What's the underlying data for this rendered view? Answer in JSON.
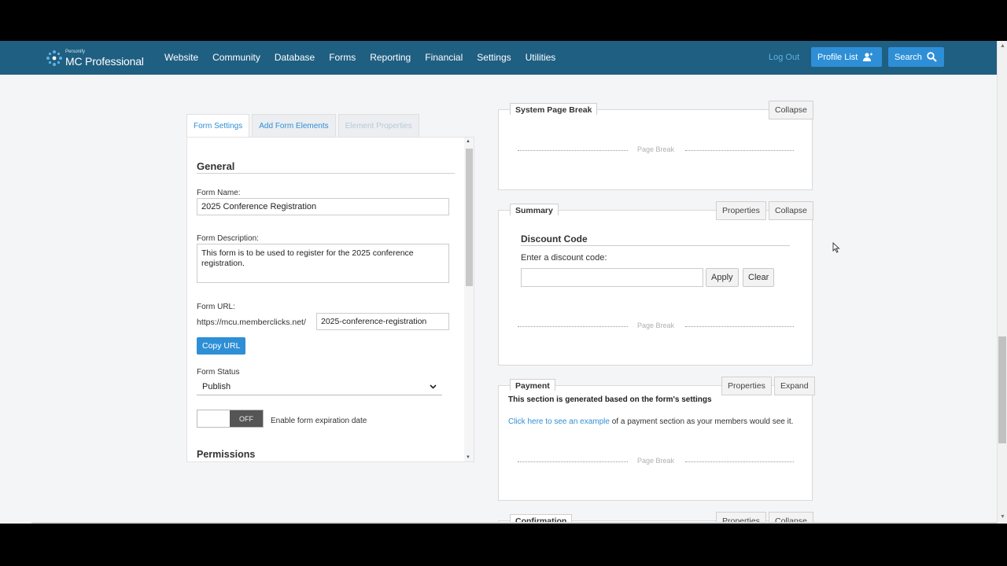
{
  "nav": {
    "logo_small": "Personify",
    "logo_big": "MC Professional",
    "items": [
      "Website",
      "Community",
      "Database",
      "Forms",
      "Reporting",
      "Financial",
      "Settings",
      "Utilities"
    ],
    "logout": "Log Out",
    "profile_list": "Profile List",
    "search": "Search"
  },
  "tabs": {
    "form_settings": "Form Settings",
    "add_form_elements": "Add Form Elements",
    "element_properties": "Element Properties"
  },
  "general": {
    "title": "General",
    "form_name_label": "Form Name:",
    "form_name_value": "2025 Conference Registration",
    "form_desc_label": "Form Description:",
    "form_desc_value": "This form is to be used to register for the 2025 conference registration.",
    "form_url_label": "Form URL:",
    "form_url_prefix": "https://mcu.memberclicks.net/",
    "form_url_slug": "2025-conference-registration",
    "copy_url": "Copy URL",
    "form_status_label": "Form Status",
    "form_status_value": "Publish",
    "toggle_state": "OFF",
    "expiration_label": "Enable form expiration date",
    "permissions_title": "Permissions"
  },
  "sections": {
    "page_break_text": "Page Break",
    "system_page_break": {
      "title": "System Page Break",
      "collapse": "Collapse"
    },
    "summary": {
      "title": "Summary",
      "properties": "Properties",
      "collapse": "Collapse",
      "discount_title": "Discount Code",
      "discount_label": "Enter a discount code:",
      "apply": "Apply",
      "clear": "Clear"
    },
    "payment": {
      "title": "Payment",
      "properties": "Properties",
      "expand": "Expand",
      "generated_note": "This section is generated based on the form's settings",
      "link_text": "Click here to see an example",
      "link_rest": " of a payment section as your members would see it."
    },
    "confirmation": {
      "title": "Confirmation",
      "properties": "Properties",
      "collapse": "Collapse"
    }
  },
  "colors": {
    "nav_bg": "#1f5f82",
    "accent": "#2e8fd6",
    "link": "#2e8fd6"
  }
}
